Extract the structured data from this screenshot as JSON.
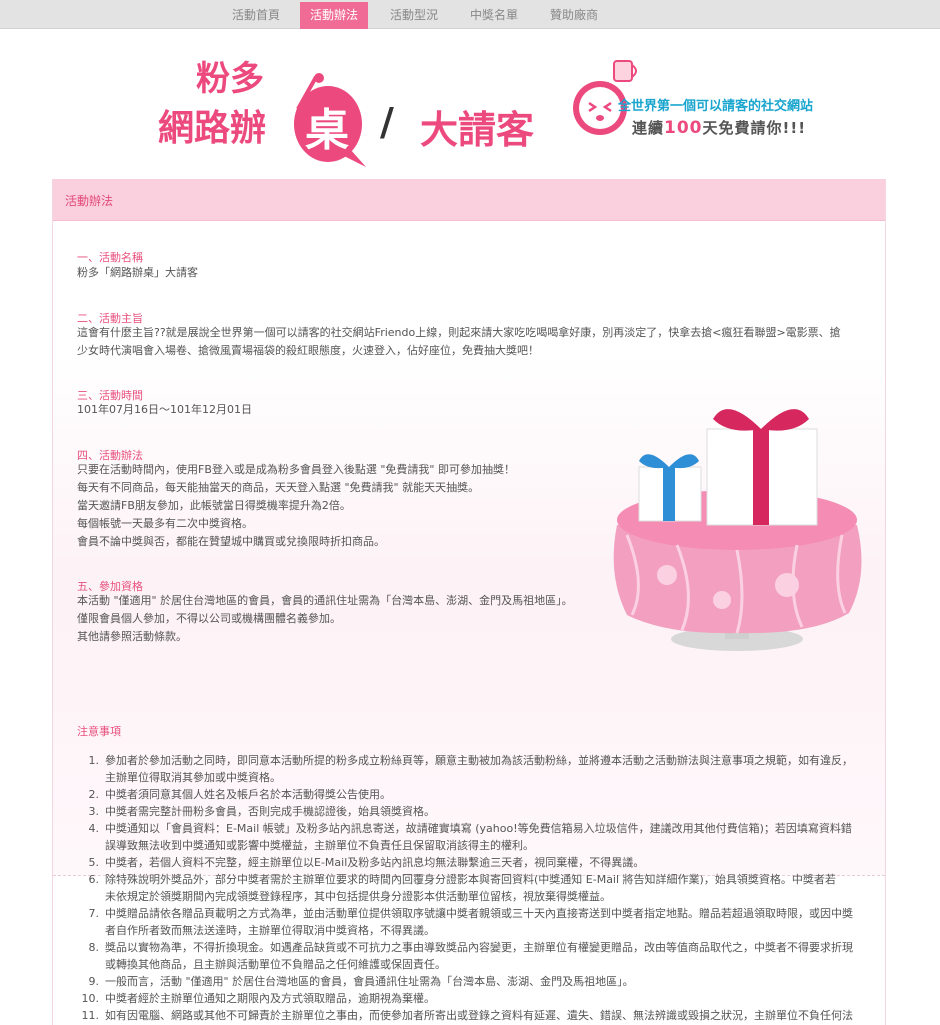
{
  "nav": {
    "items": [
      "活動首頁",
      "活動辦法",
      "活動型況",
      "中獎名單",
      "贊助廠商"
    ],
    "active_index": 1
  },
  "banner": {
    "line1": "粉多",
    "line2": "網路辦",
    "big": "桌",
    "slash": "/",
    "tail": "大請客",
    "sub1": "全世界第一個可以請客的社交網站",
    "sub2_pre": "連續",
    "sub2_hl": "100",
    "sub2_post": "天免費請你!!!",
    "accent": "#ec4a7e"
  },
  "panel": {
    "title": "活動辦法"
  },
  "sections": [
    {
      "title": "一、活動名稱",
      "lines": [
        "粉多「網路辦桌」大請客"
      ]
    },
    {
      "title": "二、活動主旨",
      "lines": [
        "這會有什麼主旨??就是展說全世界第一個可以請客的社交網站Friendo上線，則起來請大家吃吃喝喝拿好康，別再淡定了，快拿去搶<瘋狂看聯盟>電影票、搶",
        "少女時代演唱會入場卷、搶微風賣場福袋的殺紅眼態度，火速登入，佔好座位，免費抽大獎吧！"
      ]
    },
    {
      "title": "三、活動時間",
      "lines": [
        "101年07月16日～101年12月01日"
      ]
    },
    {
      "title": "四、活動辦法",
      "lines": [
        "只要在活動時間內，使用FB登入或是成為粉多會員登入後點選 \"免費請我\" 即可參加抽獎！",
        "每天有不同商品，每天能抽當天的商品，天天登入點選 \"免費請我\" 就能天天抽獎。",
        "當天邀請FB朋友參加，此帳號當日得獎機率提升為2倍。",
        "每個帳號一天最多有二次中獎資格。",
        "會員不論中獎與否，都能在贊望城中購買或兌換限時折扣商品。"
      ]
    },
    {
      "title": "五、參加資格",
      "lines": [
        "本活動 \"僅適用\" 於居住台灣地區的會員，會員的通訊住址需為「台灣本島、澎湖、金門及馬祖地區」。",
        "僅限會員個人參加，不得以公司或機構團體名義參加。",
        "其他請參照活動條款。"
      ]
    }
  ],
  "notes": {
    "title": "注意事項",
    "items": [
      {
        "num": "1.",
        "lines": [
          "參加者於參加活動之同時，即同意本活動所提的粉多成立粉絲頁等，願意主動被加為該活動粉絲，並將遵本活動之活動辦法與注意事項之規範，如有違反，",
          "主辦單位得取消其參加或中獎資格。"
        ]
      },
      {
        "num": "2.",
        "lines": [
          "中獎者須同意其個人姓名及帳戶名於本活動得獎公告使用。"
        ]
      },
      {
        "num": "3.",
        "lines": [
          "中獎者需完整計冊粉多會員，否則完成手機認證後，始具領獎資格。"
        ]
      },
      {
        "num": "4.",
        "lines": [
          "中獎通知以「會員資料：E-Mail 帳號」及粉多站內訊息寄送，故請確實填寫 (yahoo!等免費信箱易入垃圾信件，建議改用其他付費信箱)；若因填寫資料錯",
          "誤導致無法收到中獎通知或影響中獎權益，主辦單位不負責任且保留取消該得主的權利。"
        ]
      },
      {
        "num": "5.",
        "lines": [
          "中獎者，若個人資料不完整，經主辦單位以E-Mail及粉多站內訊息均無法聯繫逾三天者，視同棄權，不得異議。"
        ]
      },
      {
        "num": "6.",
        "lines": [
          "除特殊說明外獎品外，部分中獎者需於主辦單位要求的時間內回覆身分證影本與寄回資料(中獎通知 E-Mail 將告知詳細作業)，始具領獎資格。中獎者若",
          "未依規定於領獎期間內完成領獎登錄程序，其中包括提供身分證影本供活動單位留核，視放棄得獎權益。"
        ]
      },
      {
        "num": "7.",
        "lines": [
          "中獎贈品請依各贈品頁載明之方式為準，並由活動單位提供領取序號讓中獎者親領或三十天內直接寄送到中獎者指定地點。贈品若超過領取時限，或因中獎",
          "者自作所者致而無法送達時，主辦單位得取消中獎資格，不得異議。"
        ]
      },
      {
        "num": "8.",
        "lines": [
          "獎品以實物為準，不得折換現金。如遇產品缺貨或不可抗力之事由導致獎品內容變更，主辦單位有權變更贈品，改由等值商品取代之，中獎者不得要求折現",
          "或轉換其他商品，且主辦與活動單位不負贈品之任何維護或保固責任。"
        ]
      },
      {
        "num": "9.",
        "lines": [
          "一般而言，活動 \"僅適用\" 於居住台灣地區的會員，會員通訊住址需為「台灣本島、澎湖、金門及馬祖地區」。"
        ]
      },
      {
        "num": "10.",
        "lines": [
          "中獎者經於主辦單位通知之期限內及方式領取贈品，逾期視為棄權。"
        ]
      },
      {
        "num": "11.",
        "lines": [
          "如有因電腦、網路或其他不可歸責於主辦單位之事由，而使參加者所寄出或登錄之資料有延遲、遺失、錯誤、無法辨識或毀損之狀況，主辦單位不負任何法"
        ]
      }
    ]
  }
}
